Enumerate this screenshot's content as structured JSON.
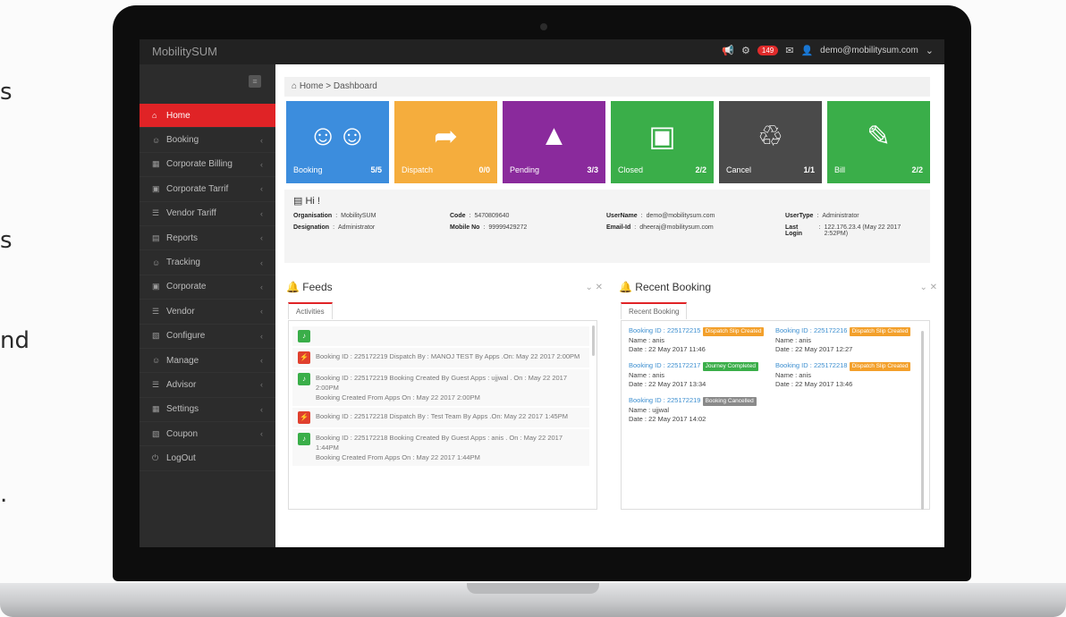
{
  "app": {
    "title": "MobilitySUM"
  },
  "topbar": {
    "notification_count": "149",
    "user": "demo@mobilitysum.com"
  },
  "left_words": [
    "s",
    "s",
    "nd",
    "."
  ],
  "breadcrumb": {
    "home": "Home",
    "sep": ">",
    "current": "Dashboard"
  },
  "sidebar": {
    "items": [
      {
        "label": "Home",
        "icon": "home-icon",
        "active": true
      },
      {
        "label": "Booking",
        "icon": "user-icon"
      },
      {
        "label": "Corporate Billing",
        "icon": "table-icon"
      },
      {
        "label": "Corporate Tarrif",
        "icon": "briefcase-icon"
      },
      {
        "label": "Vendor Tariff",
        "icon": "list-icon"
      },
      {
        "label": "Reports",
        "icon": "calendar-icon"
      },
      {
        "label": "Tracking",
        "icon": "user-icon"
      },
      {
        "label": "Corporate",
        "icon": "briefcase-icon"
      },
      {
        "label": "Vendor",
        "icon": "list-icon"
      },
      {
        "label": "Configure",
        "icon": "image-icon"
      },
      {
        "label": "Manage",
        "icon": "user-icon"
      },
      {
        "label": "Advisor",
        "icon": "list-icon"
      },
      {
        "label": "Settings",
        "icon": "table-icon"
      },
      {
        "label": "Coupon",
        "icon": "image-icon"
      },
      {
        "label": "LogOut",
        "icon": "power-icon"
      }
    ]
  },
  "tiles": [
    {
      "label": "Booking",
      "count": "5/5",
      "color": "#3c8ddd",
      "icon": "users-icon"
    },
    {
      "label": "Dispatch",
      "count": "0/0",
      "color": "#f5ad3d",
      "icon": "share-arrow-icon"
    },
    {
      "label": "Pending",
      "count": "3/3",
      "color": "#8a2a9c",
      "icon": "road-icon"
    },
    {
      "label": "Closed",
      "count": "2/2",
      "color": "#3aae49",
      "icon": "briefcase-icon"
    },
    {
      "label": "Cancel",
      "count": "1/1",
      "color": "#4a4a4a",
      "icon": "trash-icon"
    },
    {
      "label": "Bill",
      "count": "2/2",
      "color": "#3aae49",
      "icon": "edit-icon"
    }
  ],
  "profile": {
    "greeting": "Hi !",
    "fields": [
      {
        "label": "Organisation",
        "value": "MobilitySUM"
      },
      {
        "label": "Code",
        "value": "5470809640"
      },
      {
        "label": "UserName",
        "value": "demo@mobilitysum.com"
      },
      {
        "label": "UserType",
        "value": "Administrator"
      },
      {
        "label": "Designation",
        "value": "Administrator"
      },
      {
        "label": "Mobile No",
        "value": "99999429272"
      },
      {
        "label": "Email-Id",
        "value": "dheeraj@mobilitysum.com"
      },
      {
        "label": "Last Login",
        "value": "122.176.23.4 (May 22 2017 2:52PM)"
      }
    ]
  },
  "feeds": {
    "title": "Feeds",
    "tab": "Activities",
    "items": [
      {
        "type": "green",
        "text": ""
      },
      {
        "type": "red",
        "text": "Booking ID : 225172219 Dispatch By : MANOJ TEST By Apps .On: May 22 2017 2:00PM"
      },
      {
        "type": "green",
        "text": "Booking ID : 225172219 Booking Created By Guest Apps : ujjwal . On : May 22 2017 2:00PM",
        "sub": "Booking Created From Apps On : May 22 2017 2:00PM"
      },
      {
        "type": "red",
        "text": "Booking ID : 225172218 Dispatch By : Test Team By Apps .On: May 22 2017 1:45PM"
      },
      {
        "type": "green",
        "text": "Booking ID : 225172218 Booking Created By Guest Apps : anis . On : May 22 2017 1:44PM",
        "sub": "Booking Created From Apps On : May 22 2017 1:44PM"
      }
    ]
  },
  "recent": {
    "title": "Recent Booking",
    "tab": "Recent Booking",
    "bookings": [
      {
        "id": "Booking ID : 225172215",
        "tag": "Dispatch Slip Created",
        "tag_color": "orange",
        "name": "Name : anis",
        "date": "Date : 22 May 2017  11:46"
      },
      {
        "id": "Booking ID : 225172216",
        "tag": "Dispatch Slip Created",
        "tag_color": "orange",
        "name": "Name : anis",
        "date": "Date : 22 May 2017  12:27"
      },
      {
        "id": "Booking ID : 225172217",
        "tag": "Journey Completed",
        "tag_color": "green",
        "name": "Name : anis",
        "date": "Date : 22 May 2017  13:34"
      },
      {
        "id": "Booking ID : 225172218",
        "tag": "Dispatch Slip Created",
        "tag_color": "orange",
        "name": "Name : anis",
        "date": "Date : 22 May 2017  13:46"
      },
      {
        "id": "Booking ID : 225172219",
        "tag": "Booking Cancelled",
        "tag_color": "grey",
        "name": "Name : ujjwal",
        "date": "Date : 22 May 2017  14:02"
      }
    ]
  }
}
